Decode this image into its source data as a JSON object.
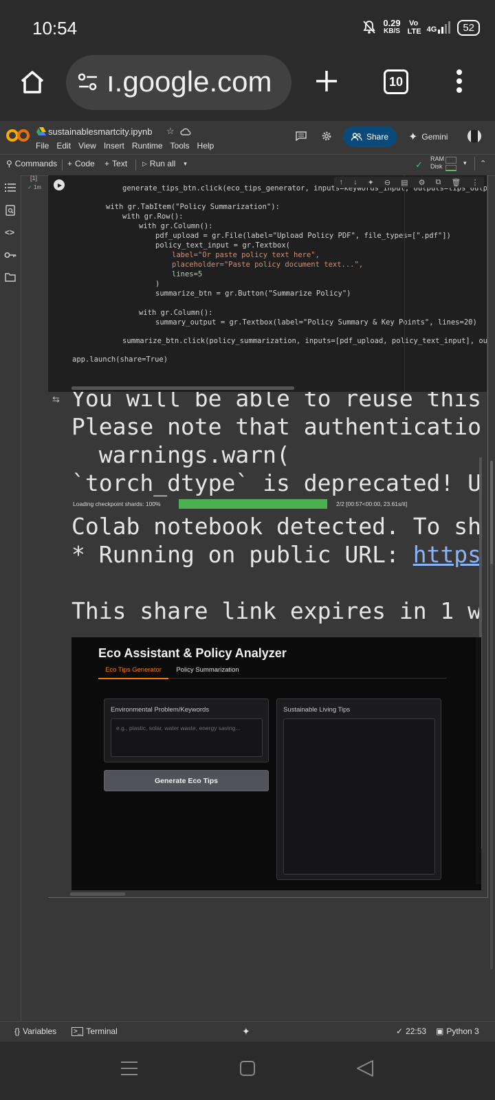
{
  "status": {
    "time": "10:54",
    "net_speed": "0.29",
    "net_unit": "KB/S",
    "volte": "Vo LTE",
    "signal": "4G",
    "battery": "52"
  },
  "browser": {
    "url": "ı.google.com",
    "tab_count": "10"
  },
  "notebook": {
    "filename": "sustainablesmartcity.ipynb",
    "menus": [
      "File",
      "Edit",
      "View",
      "Insert",
      "Runtime",
      "Tools",
      "Help"
    ],
    "share_label": "Share",
    "gemini_label": "Gemini",
    "ram_label": "RAM",
    "disk_label": "Disk"
  },
  "toolbar": {
    "commands": "Commands",
    "code": "Code",
    "text": "Text",
    "run_all": "Run all"
  },
  "cell": {
    "index": "[1]",
    "duration": "1m"
  },
  "code_lines": [
    "generate_tips_btn.click(eco_tips_generator, inputs=keywords_input, outputs=tips_outpu",
    "with gr.TabItem(\"Policy Summarization\"):",
    "with gr.Row():",
    "with gr.Column():",
    "pdf_upload = gr.File(label=\"Upload Policy PDF\", file_types=[\".pdf\"])",
    "policy_text_input = gr.Textbox(",
    "label=\"Or paste policy text here\",",
    "placeholder=\"Paste policy document text...\",",
    "lines=5",
    ")",
    "summarize_btn = gr.Button(\"Summarize Policy\")",
    "with gr.Column():",
    "summary_output = gr.Textbox(label=\"Policy Summary & Key Points\", lines=20)",
    "summarize_btn.click(policy_summarization, inputs=[pdf_upload, policy_text_input], out",
    "app.launch(share=True)"
  ],
  "output": {
    "line1": "You will be able to reuse this",
    "line2": "Please note that authenticatio",
    "line3": "  warnings.warn(",
    "line4": "`torch_dtype` is deprecated! U",
    "progress_label": "Loading checkpoint shards: 100%",
    "progress_fraction": 1.0,
    "progress_stats": "2/2 [00:57<00:00, 23.61s/it]",
    "line5": "Colab notebook detected. To sh",
    "line6_prefix": "* Running on public URL: ",
    "line6_link": "https",
    "line7": "This share link expires in 1 w"
  },
  "gradio": {
    "title": "Eco Assistant & Policy Analyzer",
    "tabs": [
      "Eco Tips Generator",
      "Policy Summarization"
    ],
    "input_label": "Environmental Problem/Keywords",
    "input_placeholder": "e.g., plastic, solar, water waste, energy saving...",
    "button_label": "Generate Eco Tips",
    "output_label": "Sustainable Living Tips"
  },
  "bottom": {
    "variables": "Variables",
    "terminal": "Terminal",
    "exec_time": "22:53",
    "kernel": "Python 3"
  },
  "colors": {
    "accent_orange": "#f57c00",
    "progress_green": "#4caf50",
    "share_blue": "#0a4a7a"
  }
}
